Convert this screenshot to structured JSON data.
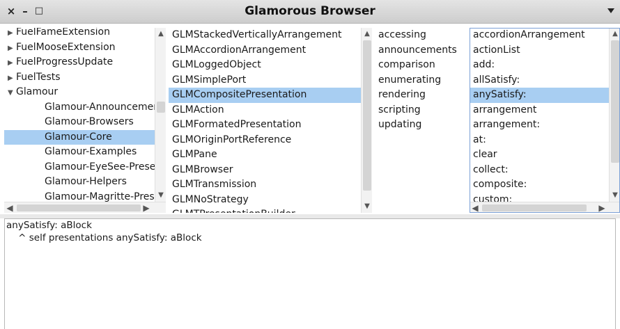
{
  "window": {
    "title": "Glamorous Browser",
    "close_glyph": "×",
    "minimize_glyph": "–",
    "maximize_glyph": "□"
  },
  "packages": {
    "items": [
      {
        "label": "FuelFameExtension",
        "tri": "▶"
      },
      {
        "label": "FuelMooseExtension",
        "tri": "▶"
      },
      {
        "label": "FuelProgressUpdate",
        "tri": "▶"
      },
      {
        "label": "FuelTests",
        "tri": "▶"
      },
      {
        "label": "Glamour",
        "tri": "▼"
      }
    ],
    "subitems": [
      "Glamour-Announcements",
      "Glamour-Browsers",
      "Glamour-Core",
      "Glamour-Examples",
      "Glamour-EyeSee-Presentations",
      "Glamour-Helpers",
      "Glamour-Magritte-Presentations"
    ],
    "selected_subitem": "Glamour-Core"
  },
  "classes": {
    "items": [
      "GLMStackedVerticallyArrangement",
      "GLMAccordionArrangement",
      "GLMLoggedObject",
      "GLMSimplePort",
      "GLMCompositePresentation",
      "GLMAction",
      "GLMFormatedPresentation",
      "GLMOriginPortReference",
      "GLMPane",
      "GLMBrowser",
      "GLMTransmission",
      "GLMNoStrategy",
      "GLMTPresentationBuilder"
    ],
    "selected": "GLMCompositePresentation"
  },
  "protocols": {
    "items": [
      "accessing",
      "announcements",
      "comparison",
      "enumerating",
      "rendering",
      "scripting",
      "updating"
    ]
  },
  "methods": {
    "items": [
      "accordionArrangement",
      "actionList",
      "add:",
      "allSatisfy:",
      "anySatisfy:",
      "arrangement",
      "arrangement:",
      "at:",
      "clear",
      "collect:",
      "composite:",
      "custom:"
    ],
    "selected": "anySatisfy:"
  },
  "editor": {
    "lines": [
      "anySatisfy: aBlock",
      "    ^ self presentations anySatisfy: aBlock"
    ]
  },
  "colors": {
    "selection": "#a8cef2",
    "focus_border": "#7ba0d6"
  }
}
